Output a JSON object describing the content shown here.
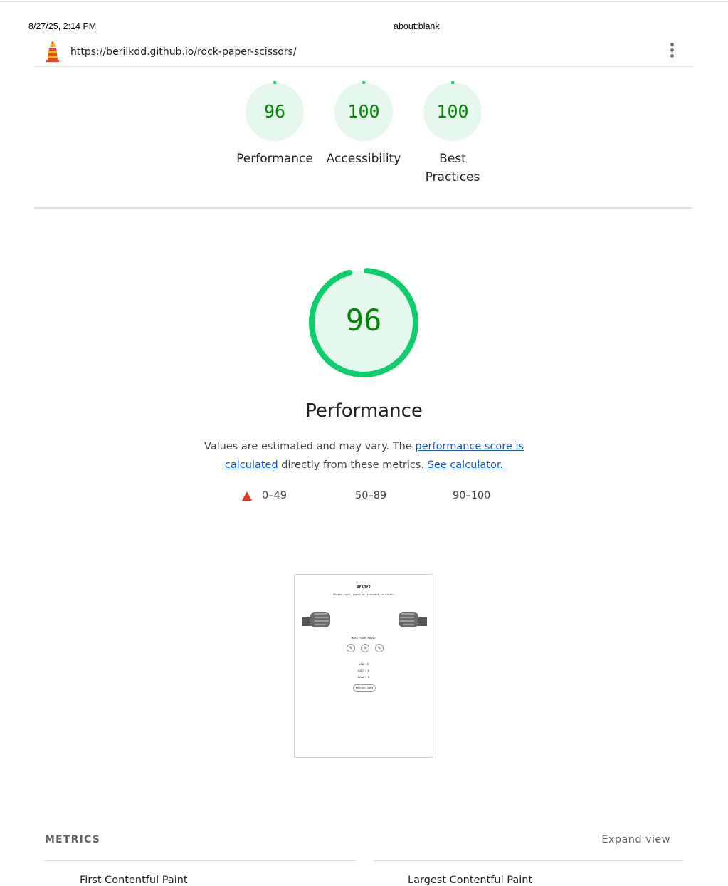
{
  "print_header": {
    "date": "8/27/25, 2:14 PM",
    "title": "about:blank"
  },
  "toolbar": {
    "url": "https://berilkdd.github.io/rock-paper-scissors/",
    "logo_icon": "lighthouse-icon",
    "menu_icon": "kebab-menu-icon"
  },
  "categories": [
    {
      "score": "96",
      "label": "Performance",
      "fraction": 0.96
    },
    {
      "score": "100",
      "label": "Accessibility",
      "fraction": 1.0
    },
    {
      "score": "100",
      "label": "Best Practices",
      "fraction": 1.0
    }
  ],
  "colors": {
    "pass": "#0cce6b",
    "pass_bg": "#e6f8ee",
    "pass_text": "#008800",
    "fail": "#e8332b",
    "link": "#1558d6"
  },
  "performance": {
    "score": "96",
    "fraction": 0.96,
    "title": "Performance",
    "desc_before": "Values are estimated and may vary. The ",
    "desc_link": "performance score is calculated",
    "desc_middle": " directly from these metrics. ",
    "calc_link": "See calculator."
  },
  "legend": [
    {
      "range": "0–49",
      "shape": "triangle"
    },
    {
      "range": "50–89",
      "shape": "square"
    },
    {
      "range": "90–100",
      "shape": "circle"
    }
  ],
  "screenshot": {
    "heading": "READY?",
    "subheading": "Choose rock, paper or scissors to start!",
    "prompt": "MAKE YOUR MOVE!",
    "win": "WIN: 0",
    "lost": "LOST: 0",
    "draw": "DRAW: 0",
    "reset": "Restart Game"
  },
  "metrics": {
    "heading": "METRICS",
    "expand": "Expand view",
    "items": [
      "First Contentful Paint",
      "Largest Contentful Paint"
    ]
  }
}
